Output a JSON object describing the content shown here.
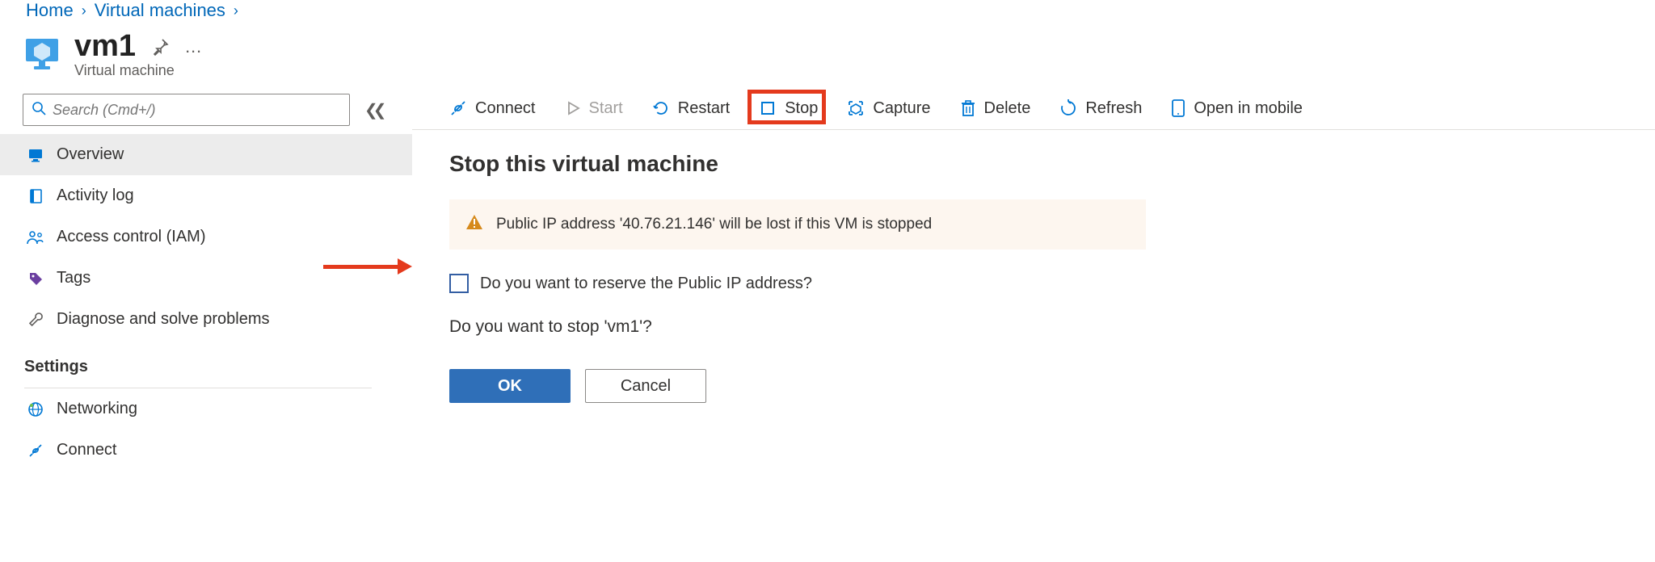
{
  "breadcrumb": {
    "home": "Home",
    "vms": "Virtual machines"
  },
  "header": {
    "title": "vm1",
    "subtitle": "Virtual machine",
    "more": "…"
  },
  "search": {
    "placeholder": "Search (Cmd+/)"
  },
  "nav": {
    "overview": "Overview",
    "activity": "Activity log",
    "iam": "Access control (IAM)",
    "tags": "Tags",
    "diag": "Diagnose and solve problems",
    "section_settings": "Settings",
    "networking": "Networking",
    "connect": "Connect"
  },
  "toolbar": {
    "connect": "Connect",
    "start": "Start",
    "restart": "Restart",
    "stop": "Stop",
    "capture": "Capture",
    "delete": "Delete",
    "refresh": "Refresh",
    "open_mobile": "Open in mobile"
  },
  "dialog": {
    "title": "Stop this virtual machine",
    "warning": "Public IP address '40.76.21.146' will be lost if this VM is stopped",
    "reserve_label": "Do you want to reserve the Public IP address?",
    "confirm_text": "Do you want to stop 'vm1'?",
    "ok": "OK",
    "cancel": "Cancel"
  }
}
